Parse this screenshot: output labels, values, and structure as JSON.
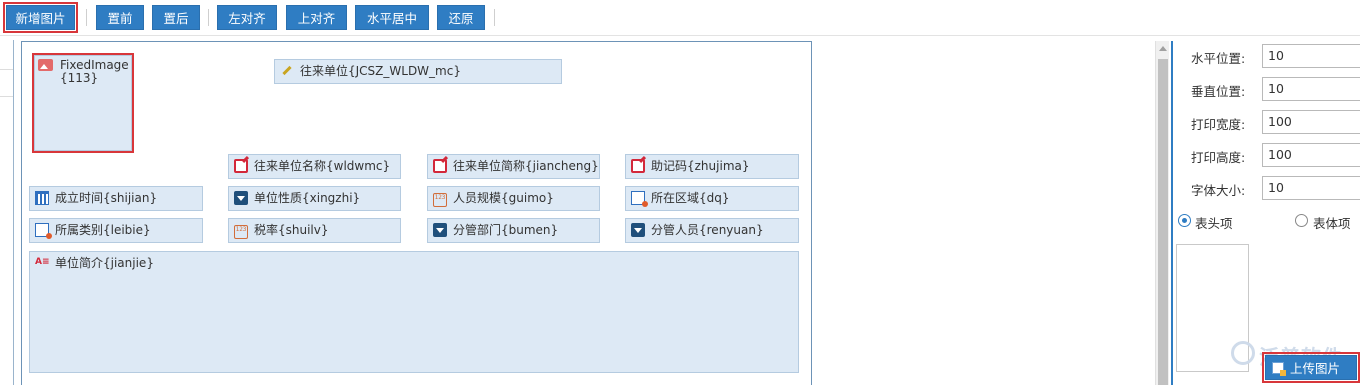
{
  "toolbar": {
    "buttons": [
      "新增图片",
      "置前",
      "置后",
      "左对齐",
      "上对齐",
      "水平居中",
      "还原"
    ]
  },
  "canvas": {
    "fixed_image": "FixedImage{113}",
    "fields": {
      "wldw_mc": "往来单位{JCSZ_WLDW_mc}",
      "wldwmc": "往来单位名称{wldwmc}",
      "jiancheng": "往来单位简称{jiancheng}",
      "zhujima": "助记码{zhujima}",
      "shijian": "成立时间{shijian}",
      "xingzhi": "单位性质{xingzhi}",
      "guimo": "人员规模{guimo}",
      "dq": "所在区域{dq}",
      "leibie": "所属类别{leibie}",
      "shuilv": "税率{shuilv}",
      "bumen": "分管部门{bumen}",
      "renyuan": "分管人员{renyuan}",
      "jianjie": "单位简介{jianjie}"
    }
  },
  "properties": {
    "rows": [
      {
        "label": "水平位置:",
        "value": "10"
      },
      {
        "label": "垂直位置:",
        "value": "10"
      },
      {
        "label": "打印宽度:",
        "value": "100"
      },
      {
        "label": "打印高度:",
        "value": "100"
      },
      {
        "label": "字体大小:",
        "value": "10"
      }
    ],
    "radio_header": "表头项",
    "radio_body": "表体项",
    "selected": "header",
    "upload_label": "上传图片",
    "watermark": "泛普软件"
  }
}
